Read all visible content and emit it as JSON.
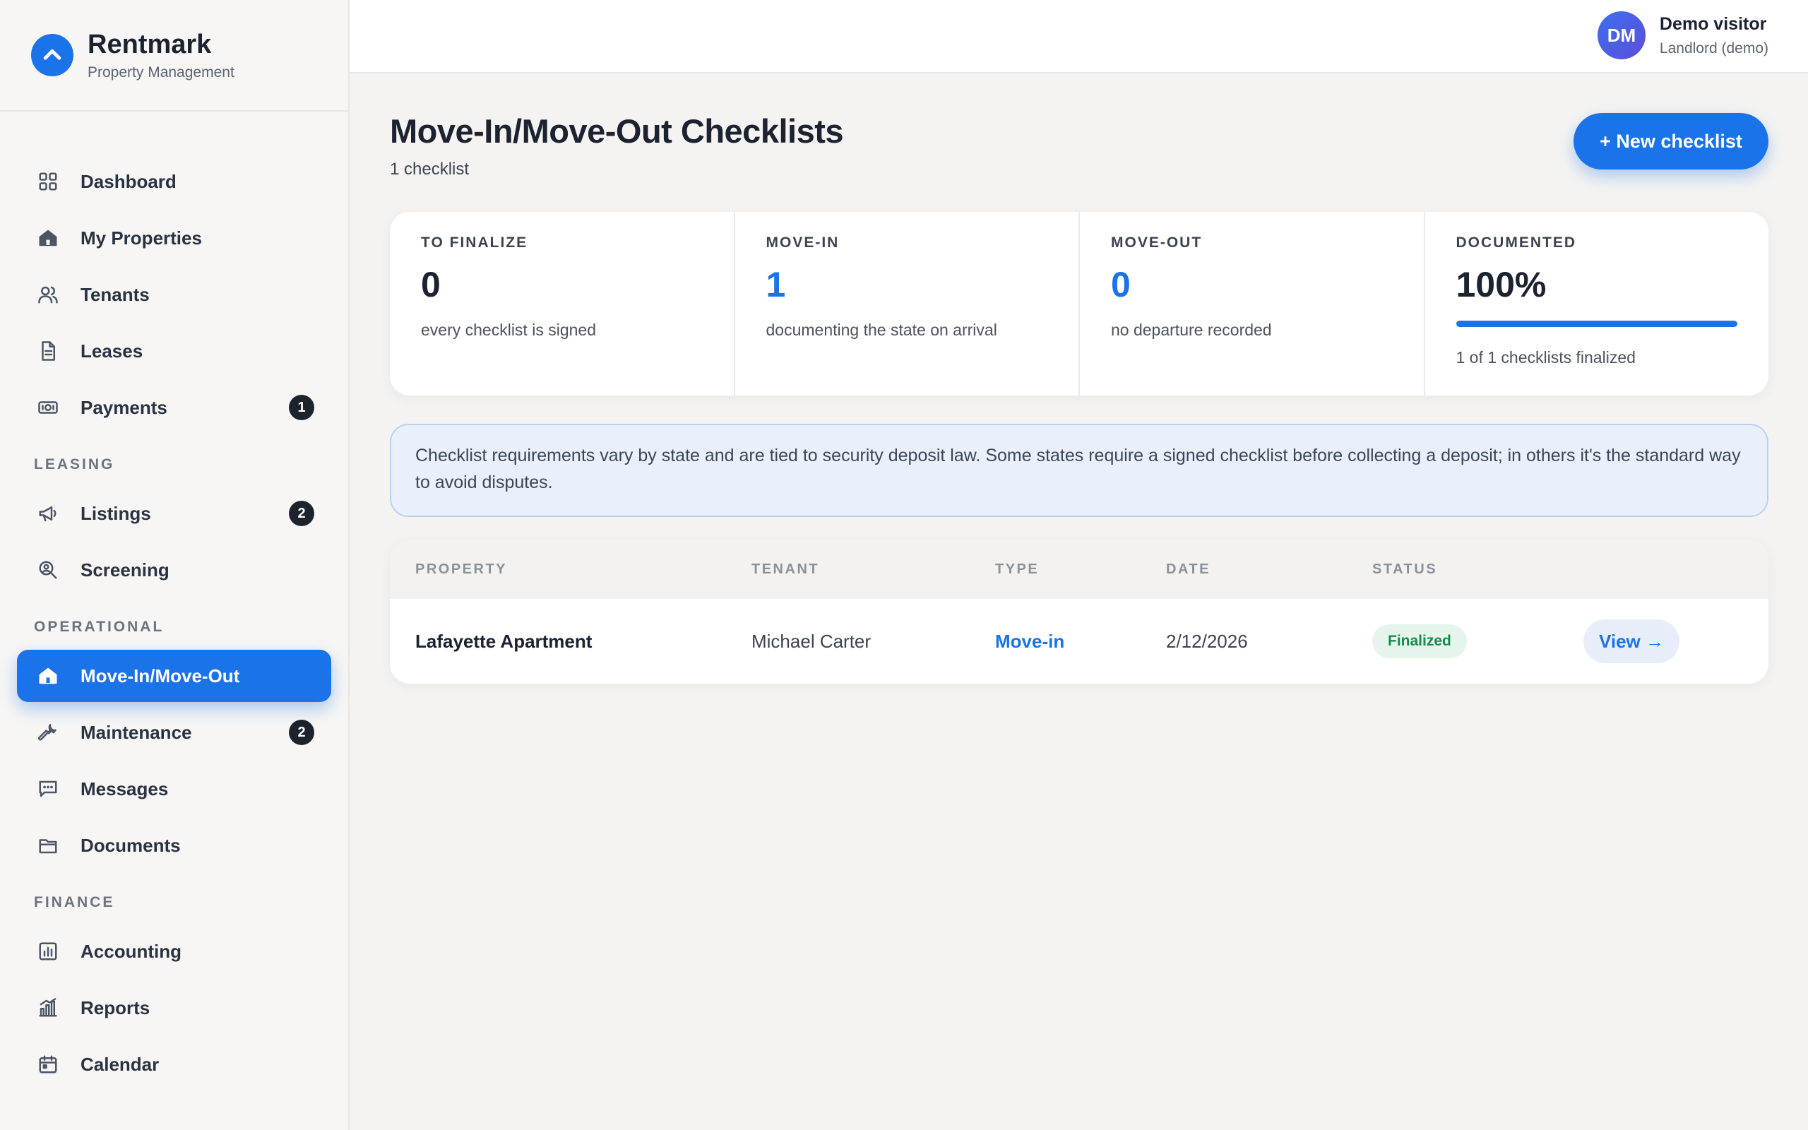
{
  "brand": {
    "name": "Rentmark",
    "subtitle": "Property Management"
  },
  "nav": {
    "items": [
      {
        "label": "Dashboard",
        "icon": "grid-icon"
      },
      {
        "label": "My Properties",
        "icon": "home-icon"
      },
      {
        "label": "Tenants",
        "icon": "users-icon"
      },
      {
        "label": "Leases",
        "icon": "document-icon"
      },
      {
        "label": "Payments",
        "icon": "banknote-icon",
        "badge": "1"
      }
    ],
    "leasing_title": "LEASING",
    "leasing": [
      {
        "label": "Listings",
        "icon": "megaphone-icon",
        "badge": "2"
      },
      {
        "label": "Screening",
        "icon": "search-person-icon"
      }
    ],
    "operational_title": "OPERATIONAL",
    "operational": [
      {
        "label": "Move-In/Move-Out",
        "icon": "home-icon",
        "active": true
      },
      {
        "label": "Maintenance",
        "icon": "wrench-icon",
        "badge": "2"
      },
      {
        "label": "Messages",
        "icon": "chat-icon"
      },
      {
        "label": "Documents",
        "icon": "folder-icon"
      }
    ],
    "finance_title": "FINANCE",
    "finance": [
      {
        "label": "Accounting",
        "icon": "ledger-icon"
      },
      {
        "label": "Reports",
        "icon": "bar-chart-icon"
      },
      {
        "label": "Calendar",
        "icon": "calendar-icon"
      }
    ]
  },
  "user": {
    "initials": "DM",
    "name": "Demo visitor",
    "role": "Landlord (demo)"
  },
  "page": {
    "title": "Move-In/Move-Out Checklists",
    "subtitle": "1 checklist",
    "new_button": "+ New checklist"
  },
  "stats": {
    "finalize": {
      "label": "TO FINALIZE",
      "value": "0",
      "note": "every checklist is signed"
    },
    "movein": {
      "label": "MOVE-IN",
      "value": "1",
      "note": "documenting the state on arrival"
    },
    "moveout": {
      "label": "MOVE-OUT",
      "value": "0",
      "note": "no departure recorded"
    },
    "documented": {
      "label": "DOCUMENTED",
      "value": "100%",
      "progress": 1.0,
      "note": "1 of 1 checklists finalized"
    }
  },
  "notice": "Checklist requirements vary by state and are tied to security deposit law. Some states require a signed checklist before collecting a deposit; in others it's the standard way to avoid disputes.",
  "table": {
    "headers": {
      "property": "PROPERTY",
      "tenant": "TENANT",
      "type": "TYPE",
      "date": "DATE",
      "status": "STATUS"
    },
    "rows": [
      {
        "property": "Lafayette Apartment",
        "tenant": "Michael Carter",
        "type": "Move-in",
        "date": "2/12/2026",
        "status": "Finalized",
        "action": "View →"
      }
    ]
  },
  "colors": {
    "accent": "#1a73e8",
    "success": "#188a4d",
    "badge": "#1d232c"
  }
}
